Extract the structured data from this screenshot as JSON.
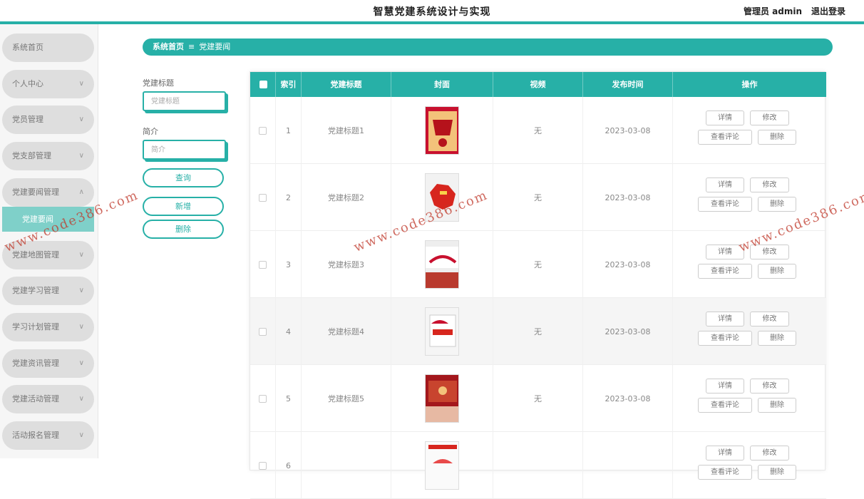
{
  "header": {
    "title": "智慧党建系统设计与实现",
    "user": "管理员 admin",
    "logout": "退出登录"
  },
  "sidebar": {
    "items": [
      {
        "label": "系统首页",
        "chev": ""
      },
      {
        "label": "个人中心",
        "chev": "∨"
      },
      {
        "label": "党员管理",
        "chev": "∨"
      },
      {
        "label": "党支部管理",
        "chev": "∨"
      },
      {
        "label": "党建要闻管理",
        "chev": "∧"
      },
      {
        "label": "党建地图管理",
        "chev": "∨"
      },
      {
        "label": "党建学习管理",
        "chev": "∨"
      },
      {
        "label": "学习计划管理",
        "chev": "∨"
      },
      {
        "label": "党建资讯管理",
        "chev": "∨"
      },
      {
        "label": "党建活动管理",
        "chev": "∨"
      },
      {
        "label": "活动报名管理",
        "chev": "∨"
      }
    ],
    "sub_item": "党建要闻"
  },
  "breadcrumb": {
    "home": "系统首页",
    "sep": "≡",
    "current": "党建要闻"
  },
  "search": {
    "title_label": "党建标题",
    "title_placeholder": "党建标题",
    "intro_label": "简介",
    "intro_placeholder": "简介",
    "query_btn": "查询",
    "add_btn": "新增",
    "delete_btn": "删除"
  },
  "table": {
    "columns": [
      "索引",
      "党建标题",
      "封面",
      "视频",
      "发布时间",
      "操作"
    ],
    "actions": {
      "detail": "详情",
      "edit": "修改",
      "comments": "查看评论",
      "delete": "删除"
    },
    "rows": [
      {
        "index": "1",
        "title": "党建标题1",
        "video": "无",
        "date": "2023-03-08"
      },
      {
        "index": "2",
        "title": "党建标题2",
        "video": "无",
        "date": "2023-03-08"
      },
      {
        "index": "3",
        "title": "党建标题3",
        "video": "无",
        "date": "2023-03-08"
      },
      {
        "index": "4",
        "title": "党建标题4",
        "video": "无",
        "date": "2023-03-08"
      },
      {
        "index": "5",
        "title": "党建标题5",
        "video": "无",
        "date": "2023-03-08"
      },
      {
        "index": "6",
        "title": "",
        "video": "",
        "date": ""
      }
    ]
  },
  "watermark": "www.code386.com",
  "colors": {
    "accent": "#27b0a7",
    "sub_active": "#7fd0c9",
    "watermark": "#c0392b"
  }
}
